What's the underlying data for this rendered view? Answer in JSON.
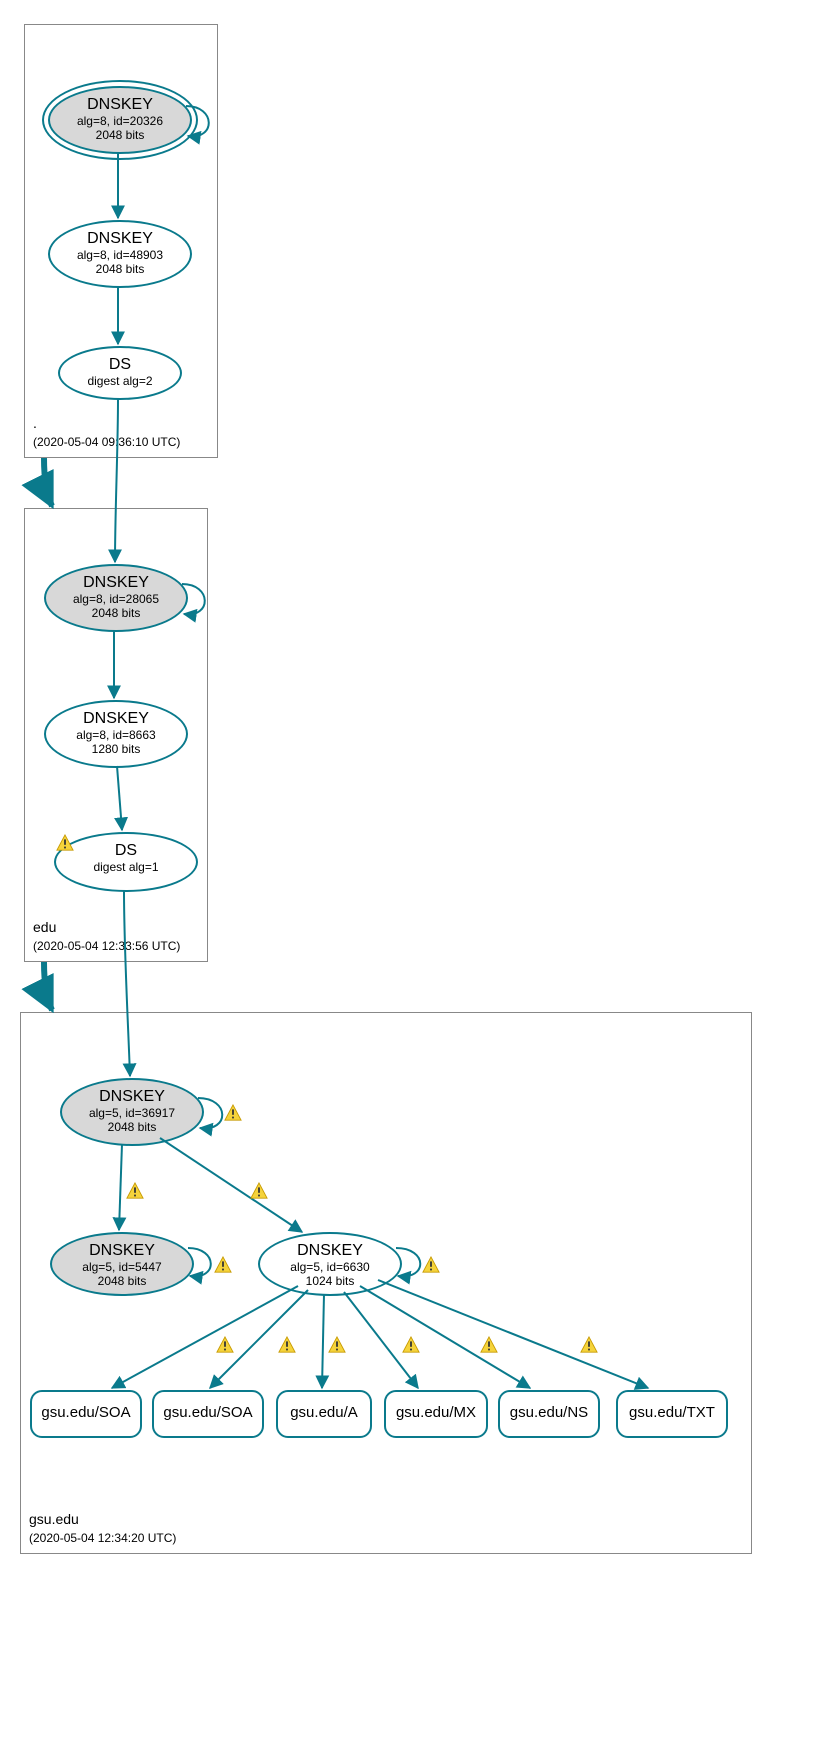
{
  "zones": {
    "root": {
      "name": ".",
      "timestamp": "(2020-05-04 09:36:10 UTC)"
    },
    "edu": {
      "name": "edu",
      "timestamp": "(2020-05-04 12:33:56 UTC)"
    },
    "gsu": {
      "name": "gsu.edu",
      "timestamp": "(2020-05-04 12:34:20 UTC)"
    }
  },
  "nodes": {
    "root_ksk": {
      "title": "DNSKEY",
      "sub1": "alg=8, id=20326",
      "sub2": "2048 bits"
    },
    "root_zsk": {
      "title": "DNSKEY",
      "sub1": "alg=8, id=48903",
      "sub2": "2048 bits"
    },
    "root_ds": {
      "title": "DS",
      "sub1": "digest alg=2",
      "sub2": ""
    },
    "edu_ksk": {
      "title": "DNSKEY",
      "sub1": "alg=8, id=28065",
      "sub2": "2048 bits"
    },
    "edu_zsk": {
      "title": "DNSKEY",
      "sub1": "alg=8, id=8663",
      "sub2": "1280 bits"
    },
    "edu_ds": {
      "title": "DS",
      "sub1": "digest alg=1",
      "sub2": ""
    },
    "gsu_ksk": {
      "title": "DNSKEY",
      "sub1": "alg=5, id=36917",
      "sub2": "2048 bits"
    },
    "gsu_k2": {
      "title": "DNSKEY",
      "sub1": "alg=5, id=5447",
      "sub2": "2048 bits"
    },
    "gsu_zsk": {
      "title": "DNSKEY",
      "sub1": "alg=5, id=6630",
      "sub2": "1024 bits"
    },
    "rr_soa1": {
      "title": "gsu.edu/SOA"
    },
    "rr_soa2": {
      "title": "gsu.edu/SOA"
    },
    "rr_a": {
      "title": "gsu.edu/A"
    },
    "rr_mx": {
      "title": "gsu.edu/MX"
    },
    "rr_ns": {
      "title": "gsu.edu/NS"
    },
    "rr_txt": {
      "title": "gsu.edu/TXT"
    }
  },
  "colors": {
    "edge": "#0a7a8c",
    "warnFill": "#f5d33b",
    "warnStroke": "#c79a00"
  },
  "chart_data": {
    "type": "graph",
    "description": "DNSSEC authentication chain / delegation graph",
    "zones": [
      {
        "name": ".",
        "analyzed": "2020-05-04 09:36:10 UTC"
      },
      {
        "name": "edu",
        "analyzed": "2020-05-04 12:33:56 UTC"
      },
      {
        "name": "gsu.edu",
        "analyzed": "2020-05-04 12:34:20 UTC"
      }
    ],
    "nodes": [
      {
        "id": "root_ksk",
        "zone": ".",
        "type": "DNSKEY",
        "alg": 8,
        "key_id": 20326,
        "bits": 2048,
        "trust_anchor": true,
        "sep": true
      },
      {
        "id": "root_zsk",
        "zone": ".",
        "type": "DNSKEY",
        "alg": 8,
        "key_id": 48903,
        "bits": 2048
      },
      {
        "id": "root_ds",
        "zone": ".",
        "type": "DS",
        "digest_alg": 2
      },
      {
        "id": "edu_ksk",
        "zone": "edu",
        "type": "DNSKEY",
        "alg": 8,
        "key_id": 28065,
        "bits": 2048,
        "sep": true
      },
      {
        "id": "edu_zsk",
        "zone": "edu",
        "type": "DNSKEY",
        "alg": 8,
        "key_id": 8663,
        "bits": 1280
      },
      {
        "id": "edu_ds",
        "zone": "edu",
        "type": "DS",
        "digest_alg": 1,
        "warning": true
      },
      {
        "id": "gsu_ksk",
        "zone": "gsu.edu",
        "type": "DNSKEY",
        "alg": 5,
        "key_id": 36917,
        "bits": 2048,
        "sep": true,
        "warning": true
      },
      {
        "id": "gsu_k2",
        "zone": "gsu.edu",
        "type": "DNSKEY",
        "alg": 5,
        "key_id": 5447,
        "bits": 2048,
        "sep": true,
        "warning": true
      },
      {
        "id": "gsu_zsk",
        "zone": "gsu.edu",
        "type": "DNSKEY",
        "alg": 5,
        "key_id": 6630,
        "bits": 1024,
        "warning": true
      },
      {
        "id": "rr_soa1",
        "zone": "gsu.edu",
        "type": "RRset",
        "name": "gsu.edu",
        "rrtype": "SOA"
      },
      {
        "id": "rr_soa2",
        "zone": "gsu.edu",
        "type": "RRset",
        "name": "gsu.edu",
        "rrtype": "SOA"
      },
      {
        "id": "rr_a",
        "zone": "gsu.edu",
        "type": "RRset",
        "name": "gsu.edu",
        "rrtype": "A"
      },
      {
        "id": "rr_mx",
        "zone": "gsu.edu",
        "type": "RRset",
        "name": "gsu.edu",
        "rrtype": "MX"
      },
      {
        "id": "rr_ns",
        "zone": "gsu.edu",
        "type": "RRset",
        "name": "gsu.edu",
        "rrtype": "NS"
      },
      {
        "id": "rr_txt",
        "zone": "gsu.edu",
        "type": "RRset",
        "name": "gsu.edu",
        "rrtype": "TXT"
      }
    ],
    "edges": [
      {
        "from": "root_ksk",
        "to": "root_ksk",
        "self": true
      },
      {
        "from": "root_ksk",
        "to": "root_zsk"
      },
      {
        "from": "root_zsk",
        "to": "root_ds"
      },
      {
        "from": "root_ds",
        "to": "edu_ksk"
      },
      {
        "from": "edu_ksk",
        "to": "edu_ksk",
        "self": true
      },
      {
        "from": "edu_ksk",
        "to": "edu_zsk"
      },
      {
        "from": "edu_zsk",
        "to": "edu_ds"
      },
      {
        "from": "edu_ds",
        "to": "gsu_ksk"
      },
      {
        "from": "gsu_ksk",
        "to": "gsu_ksk",
        "self": true,
        "warning": true
      },
      {
        "from": "gsu_ksk",
        "to": "gsu_k2",
        "warning": true
      },
      {
        "from": "gsu_k2",
        "to": "gsu_k2",
        "self": true,
        "warning": true
      },
      {
        "from": "gsu_ksk",
        "to": "gsu_zsk",
        "warning": true
      },
      {
        "from": "gsu_zsk",
        "to": "gsu_zsk",
        "self": true,
        "warning": true
      },
      {
        "from": "gsu_zsk",
        "to": "rr_soa1",
        "warning": true
      },
      {
        "from": "gsu_zsk",
        "to": "rr_soa2",
        "warning": true
      },
      {
        "from": "gsu_zsk",
        "to": "rr_a",
        "warning": true
      },
      {
        "from": "gsu_zsk",
        "to": "rr_mx",
        "warning": true
      },
      {
        "from": "gsu_zsk",
        "to": "rr_ns",
        "warning": true
      },
      {
        "from": "gsu_zsk",
        "to": "rr_txt",
        "warning": true
      }
    ],
    "delegations": [
      {
        "from_zone": ".",
        "to_zone": "edu"
      },
      {
        "from_zone": "edu",
        "to_zone": "gsu.edu"
      }
    ]
  }
}
